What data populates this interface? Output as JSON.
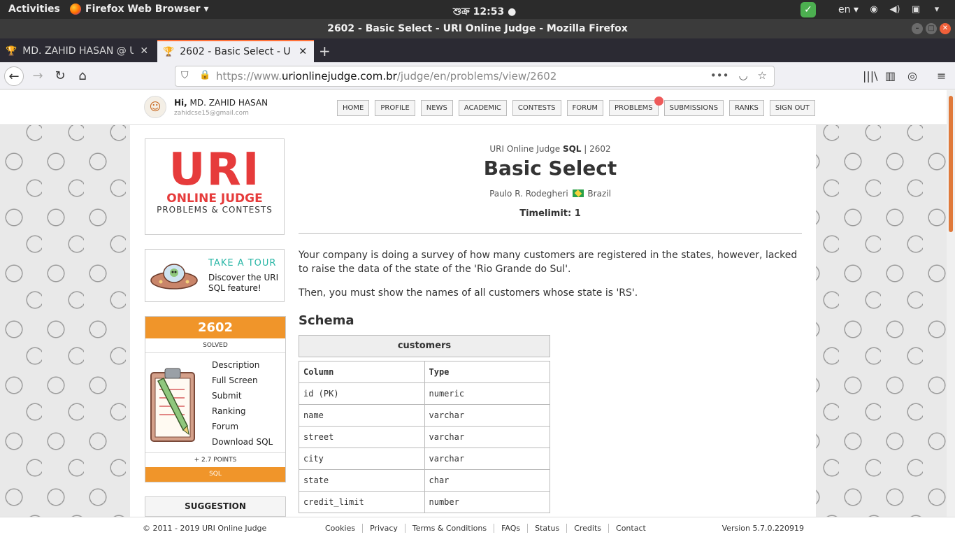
{
  "topbar": {
    "activities": "Activities",
    "app_menu": "Firefox Web Browser ▾",
    "clock": "শুক্র 12:53 ●",
    "lang": "en ▾"
  },
  "window": {
    "title": "2602 - Basic Select - URI Online Judge - Mozilla Firefox"
  },
  "tabs": [
    {
      "title": "MD. ZAHID HASAN @ URI",
      "active": false
    },
    {
      "title": "2602 - Basic Select - URI O",
      "active": true
    }
  ],
  "urlbar": {
    "prefix": "https://www.",
    "domain": "urionlinejudge.com.br",
    "path": "/judge/en/problems/view/2602"
  },
  "header": {
    "greeting": "Hi,",
    "user": "MD. ZAHID HASAN",
    "email": "zahidcse15@gmail.com",
    "menu": [
      "HOME",
      "PROFILE",
      "NEWS",
      "ACADEMIC",
      "CONTESTS",
      "FORUM",
      "PROBLEMS",
      "SUBMISSIONS",
      "RANKS",
      "SIGN OUT"
    ]
  },
  "logo": {
    "main": "URI",
    "sub": "ONLINE JUDGE",
    "tagline": "PROBLEMS & CONTESTS"
  },
  "tour": {
    "title": "TAKE A TOUR",
    "desc": "Discover the URI SQL feature!"
  },
  "problem_box": {
    "number": "2602",
    "status": "SOLVED",
    "links": [
      "Description",
      "Full Screen",
      "Submit",
      "Ranking",
      "Forum",
      "Download SQL"
    ],
    "points": "+ 2.7 POINTS",
    "category": "SQL"
  },
  "suggestion": "SUGGESTION",
  "problem": {
    "crumb_site": "URI Online Judge",
    "crumb_cat": "SQL",
    "crumb_sep": " | ",
    "crumb_id": "2602",
    "title": "Basic Select",
    "author": "Paulo R. Rodegheri",
    "country": "Brazil",
    "timelimit": "Timelimit: 1",
    "desc1": "Your company is doing a survey of how many customers are registered in the states, however, lacked to raise the data of the state of the 'Rio Grande do Sul'.",
    "desc2": "Then, you must show the names of all customers whose state is 'RS'.",
    "schema_heading": "Schema",
    "table_name": "customers",
    "columns_header": [
      "Column",
      "Type"
    ],
    "rows": [
      [
        "id (PK)",
        "numeric"
      ],
      [
        "name",
        "varchar"
      ],
      [
        "street",
        "varchar"
      ],
      [
        "city",
        "varchar"
      ],
      [
        "state",
        "char"
      ],
      [
        "credit_limit",
        "number"
      ]
    ]
  },
  "footer": {
    "copyright": "© 2011 - 2019 URI Online Judge",
    "links": [
      "Cookies",
      "Privacy",
      "Terms & Conditions",
      "FAQs",
      "Status",
      "Credits",
      "Contact"
    ],
    "version": "Version 5.7.0.220919"
  },
  "colors": {
    "accent": "#f0952a",
    "logo_red": "#e63b3b",
    "tour_teal": "#29b6a6"
  }
}
